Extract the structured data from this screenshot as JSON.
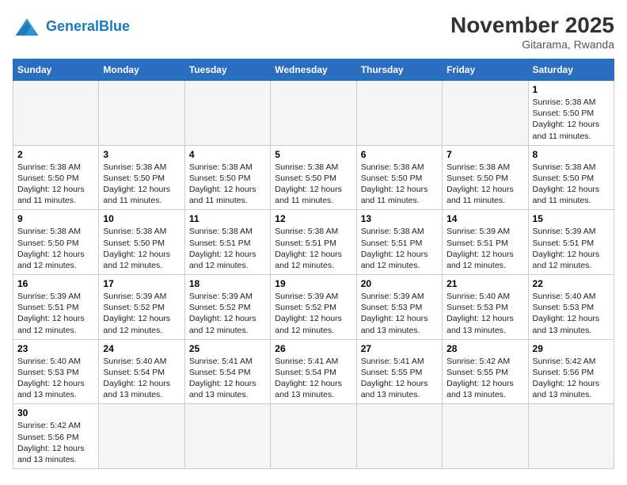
{
  "header": {
    "logo_general": "General",
    "logo_blue": "Blue",
    "month_title": "November 2025",
    "location": "Gitarama, Rwanda"
  },
  "days_of_week": [
    "Sunday",
    "Monday",
    "Tuesday",
    "Wednesday",
    "Thursday",
    "Friday",
    "Saturday"
  ],
  "weeks": [
    [
      {
        "day": "",
        "info": ""
      },
      {
        "day": "",
        "info": ""
      },
      {
        "day": "",
        "info": ""
      },
      {
        "day": "",
        "info": ""
      },
      {
        "day": "",
        "info": ""
      },
      {
        "day": "",
        "info": ""
      },
      {
        "day": "1",
        "info": "Sunrise: 5:38 AM\nSunset: 5:50 PM\nDaylight: 12 hours and 11 minutes."
      }
    ],
    [
      {
        "day": "2",
        "info": "Sunrise: 5:38 AM\nSunset: 5:50 PM\nDaylight: 12 hours and 11 minutes."
      },
      {
        "day": "3",
        "info": "Sunrise: 5:38 AM\nSunset: 5:50 PM\nDaylight: 12 hours and 11 minutes."
      },
      {
        "day": "4",
        "info": "Sunrise: 5:38 AM\nSunset: 5:50 PM\nDaylight: 12 hours and 11 minutes."
      },
      {
        "day": "5",
        "info": "Sunrise: 5:38 AM\nSunset: 5:50 PM\nDaylight: 12 hours and 11 minutes."
      },
      {
        "day": "6",
        "info": "Sunrise: 5:38 AM\nSunset: 5:50 PM\nDaylight: 12 hours and 11 minutes."
      },
      {
        "day": "7",
        "info": "Sunrise: 5:38 AM\nSunset: 5:50 PM\nDaylight: 12 hours and 11 minutes."
      },
      {
        "day": "8",
        "info": "Sunrise: 5:38 AM\nSunset: 5:50 PM\nDaylight: 12 hours and 11 minutes."
      }
    ],
    [
      {
        "day": "9",
        "info": "Sunrise: 5:38 AM\nSunset: 5:50 PM\nDaylight: 12 hours and 12 minutes."
      },
      {
        "day": "10",
        "info": "Sunrise: 5:38 AM\nSunset: 5:50 PM\nDaylight: 12 hours and 12 minutes."
      },
      {
        "day": "11",
        "info": "Sunrise: 5:38 AM\nSunset: 5:51 PM\nDaylight: 12 hours and 12 minutes."
      },
      {
        "day": "12",
        "info": "Sunrise: 5:38 AM\nSunset: 5:51 PM\nDaylight: 12 hours and 12 minutes."
      },
      {
        "day": "13",
        "info": "Sunrise: 5:38 AM\nSunset: 5:51 PM\nDaylight: 12 hours and 12 minutes."
      },
      {
        "day": "14",
        "info": "Sunrise: 5:39 AM\nSunset: 5:51 PM\nDaylight: 12 hours and 12 minutes."
      },
      {
        "day": "15",
        "info": "Sunrise: 5:39 AM\nSunset: 5:51 PM\nDaylight: 12 hours and 12 minutes."
      }
    ],
    [
      {
        "day": "16",
        "info": "Sunrise: 5:39 AM\nSunset: 5:51 PM\nDaylight: 12 hours and 12 minutes."
      },
      {
        "day": "17",
        "info": "Sunrise: 5:39 AM\nSunset: 5:52 PM\nDaylight: 12 hours and 12 minutes."
      },
      {
        "day": "18",
        "info": "Sunrise: 5:39 AM\nSunset: 5:52 PM\nDaylight: 12 hours and 12 minutes."
      },
      {
        "day": "19",
        "info": "Sunrise: 5:39 AM\nSunset: 5:52 PM\nDaylight: 12 hours and 12 minutes."
      },
      {
        "day": "20",
        "info": "Sunrise: 5:39 AM\nSunset: 5:53 PM\nDaylight: 12 hours and 13 minutes."
      },
      {
        "day": "21",
        "info": "Sunrise: 5:40 AM\nSunset: 5:53 PM\nDaylight: 12 hours and 13 minutes."
      },
      {
        "day": "22",
        "info": "Sunrise: 5:40 AM\nSunset: 5:53 PM\nDaylight: 12 hours and 13 minutes."
      }
    ],
    [
      {
        "day": "23",
        "info": "Sunrise: 5:40 AM\nSunset: 5:53 PM\nDaylight: 12 hours and 13 minutes."
      },
      {
        "day": "24",
        "info": "Sunrise: 5:40 AM\nSunset: 5:54 PM\nDaylight: 12 hours and 13 minutes."
      },
      {
        "day": "25",
        "info": "Sunrise: 5:41 AM\nSunset: 5:54 PM\nDaylight: 12 hours and 13 minutes."
      },
      {
        "day": "26",
        "info": "Sunrise: 5:41 AM\nSunset: 5:54 PM\nDaylight: 12 hours and 13 minutes."
      },
      {
        "day": "27",
        "info": "Sunrise: 5:41 AM\nSunset: 5:55 PM\nDaylight: 12 hours and 13 minutes."
      },
      {
        "day": "28",
        "info": "Sunrise: 5:42 AM\nSunset: 5:55 PM\nDaylight: 12 hours and 13 minutes."
      },
      {
        "day": "29",
        "info": "Sunrise: 5:42 AM\nSunset: 5:56 PM\nDaylight: 12 hours and 13 minutes."
      }
    ],
    [
      {
        "day": "30",
        "info": "Sunrise: 5:42 AM\nSunset: 5:56 PM\nDaylight: 12 hours and 13 minutes."
      },
      {
        "day": "",
        "info": ""
      },
      {
        "day": "",
        "info": ""
      },
      {
        "day": "",
        "info": ""
      },
      {
        "day": "",
        "info": ""
      },
      {
        "day": "",
        "info": ""
      },
      {
        "day": "",
        "info": ""
      }
    ]
  ]
}
